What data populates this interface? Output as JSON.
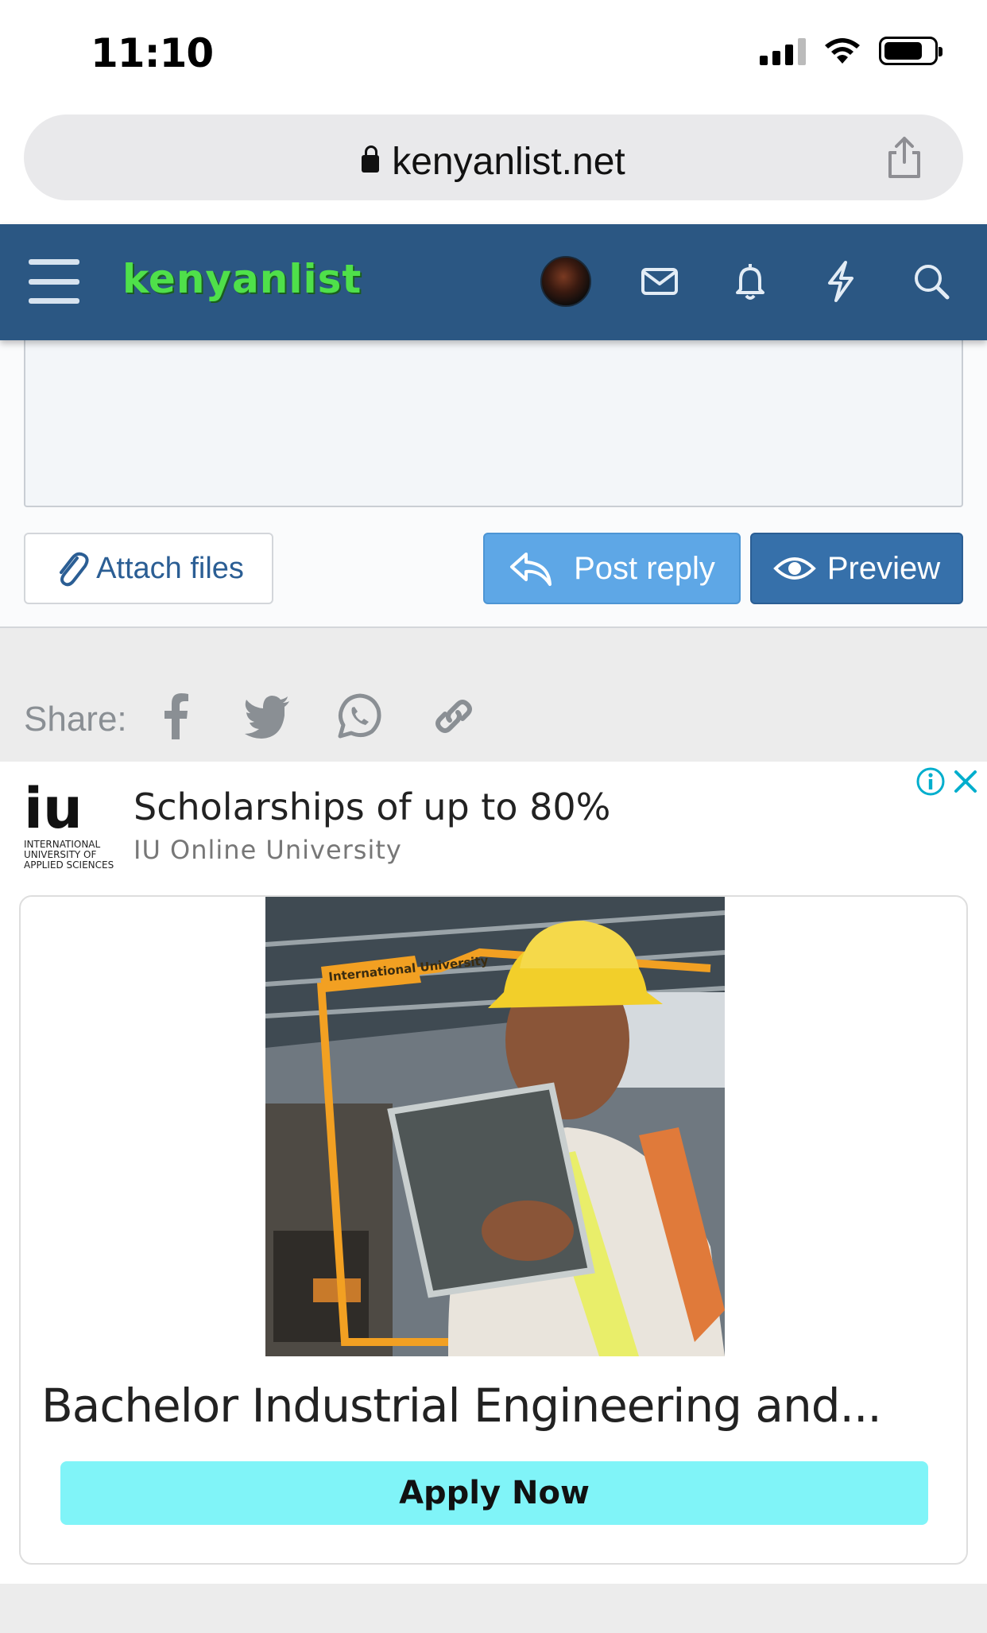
{
  "status_bar": {
    "time": "11:10"
  },
  "browser": {
    "url": "kenyanlist.net"
  },
  "header": {
    "logo_text": "kenyanlist"
  },
  "editor": {
    "attach_label": "Attach files",
    "post_reply_label": "Post reply",
    "preview_label": "Preview"
  },
  "share": {
    "label": "Share:"
  },
  "ad": {
    "logo_big": "iu",
    "logo_small": "INTERNATIONAL UNIVERSITY OF APPLIED SCIENCES",
    "headline": "Scholarships of up to 80%",
    "advertiser": "IU Online University",
    "image_banner": "International University",
    "card_title": "Bachelor Industrial Engineering and...",
    "cta_label": "Apply Now"
  },
  "colors": {
    "header_bg": "#2b5783",
    "logo_green": "#4fe04a",
    "post_reply_bg": "#5ea7e6",
    "preview_bg": "#3670aa",
    "cta_bg": "#80f4f8",
    "ad_info_blue": "#00aecd"
  },
  "icons": {
    "header": [
      "menu-icon",
      "avatar",
      "envelope-icon",
      "bell-icon",
      "bolt-icon",
      "search-icon"
    ],
    "share": [
      "facebook-icon",
      "twitter-icon",
      "whatsapp-icon",
      "link-icon"
    ]
  }
}
